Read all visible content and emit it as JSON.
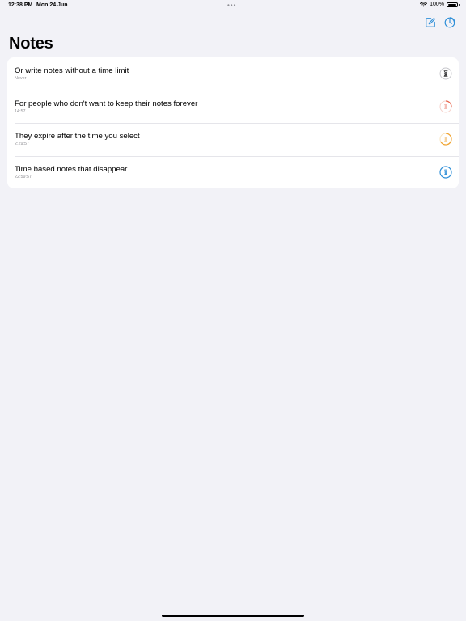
{
  "status_bar": {
    "time": "12:38 PM",
    "date": "Mon 24 Jun",
    "battery": "100%"
  },
  "page": {
    "title": "Notes"
  },
  "notes": [
    {
      "title": "Or write notes without a time limit",
      "subtitle": "Never",
      "icon": "hourglass-icon",
      "color": "#6e6e73"
    },
    {
      "title": "For people who don't want to keep their notes forever",
      "subtitle": "14:57",
      "icon": "timer-ring-icon",
      "color": "#e8624a"
    },
    {
      "title": "They expire after the time you select",
      "subtitle": "2:29:57",
      "icon": "timer-ring-icon",
      "color": "#f0a430"
    },
    {
      "title": "Time based notes that disappear",
      "subtitle": "22:59:57",
      "icon": "timer-ring-icon",
      "color": "#2f8fd8"
    }
  ],
  "colors": {
    "accent": "#2f8fd8",
    "background": "#f2f2f7",
    "card": "#ffffff"
  }
}
